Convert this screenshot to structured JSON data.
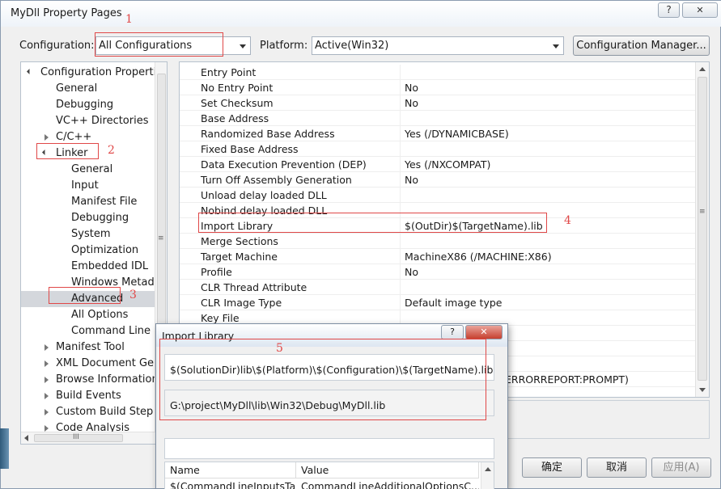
{
  "window": {
    "title": "MyDll Property Pages",
    "help_label": "?",
    "close_label": "✕"
  },
  "top": {
    "configuration_label": "Configuration:",
    "configuration_value": "All Configurations",
    "platform_label": "Platform:",
    "platform_value": "Active(Win32)",
    "config_manager_label": "Configuration Manager..."
  },
  "tree": {
    "items": [
      {
        "label": "Configuration Properties"
      },
      {
        "label": "General"
      },
      {
        "label": "Debugging"
      },
      {
        "label": "VC++ Directories"
      },
      {
        "label": "C/C++"
      },
      {
        "label": "Linker"
      },
      {
        "label": "General"
      },
      {
        "label": "Input"
      },
      {
        "label": "Manifest File"
      },
      {
        "label": "Debugging"
      },
      {
        "label": "System"
      },
      {
        "label": "Optimization"
      },
      {
        "label": "Embedded IDL"
      },
      {
        "label": "Windows Metadata"
      },
      {
        "label": "Advanced"
      },
      {
        "label": "All Options"
      },
      {
        "label": "Command Line"
      },
      {
        "label": "Manifest Tool"
      },
      {
        "label": "XML Document Generator"
      },
      {
        "label": "Browse Information"
      },
      {
        "label": "Build Events"
      },
      {
        "label": "Custom Build Step"
      },
      {
        "label": "Code Analysis"
      }
    ],
    "hscroll_grip": "III"
  },
  "grid": {
    "rows": [
      {
        "name": "Entry Point",
        "value": ""
      },
      {
        "name": "No Entry Point",
        "value": "No"
      },
      {
        "name": "Set Checksum",
        "value": "No"
      },
      {
        "name": "Base Address",
        "value": ""
      },
      {
        "name": "Randomized Base Address",
        "value": "Yes (/DYNAMICBASE)"
      },
      {
        "name": "Fixed Base Address",
        "value": ""
      },
      {
        "name": "Data Execution Prevention (DEP)",
        "value": "Yes (/NXCOMPAT)"
      },
      {
        "name": "Turn Off Assembly Generation",
        "value": "No"
      },
      {
        "name": "Unload delay loaded DLL",
        "value": ""
      },
      {
        "name": "Nobind delay loaded DLL",
        "value": ""
      },
      {
        "name": "Import Library",
        "value": "$(OutDir)$(TargetName).lib"
      },
      {
        "name": "Merge Sections",
        "value": ""
      },
      {
        "name": "Target Machine",
        "value": "MachineX86 (/MACHINE:X86)"
      },
      {
        "name": "Profile",
        "value": "No"
      },
      {
        "name": "CLR Thread Attribute",
        "value": ""
      },
      {
        "name": "CLR Image Type",
        "value": "Default image type"
      },
      {
        "name": "Key File",
        "value": ""
      }
    ],
    "partial_value": "ERRORREPORT:PROMPT)"
  },
  "buttons": {
    "ok": "确定",
    "cancel": "取消",
    "apply": "应用(A)"
  },
  "annotations": [
    "1",
    "2",
    "3",
    "4",
    "5"
  ],
  "dialog": {
    "title": "Import Library",
    "help_label": "?",
    "close_label": "✕",
    "input_value": "$(SolutionDir)lib\\$(Platform)\\$(Configuration)\\$(TargetName).lib",
    "evaluated_value": "G:\\project\\MyDll\\lib\\Win32\\Debug\\MyDll.lib",
    "macro_columns": [
      "Name",
      "Value"
    ],
    "macro_row_name": "$(CommandLineInputsTar...",
    "macro_row_value": "CommandLineAdditionalOptionsC..."
  },
  "colors": {
    "annotation": "#e04848",
    "selected_tree": "#d4d7dc"
  }
}
